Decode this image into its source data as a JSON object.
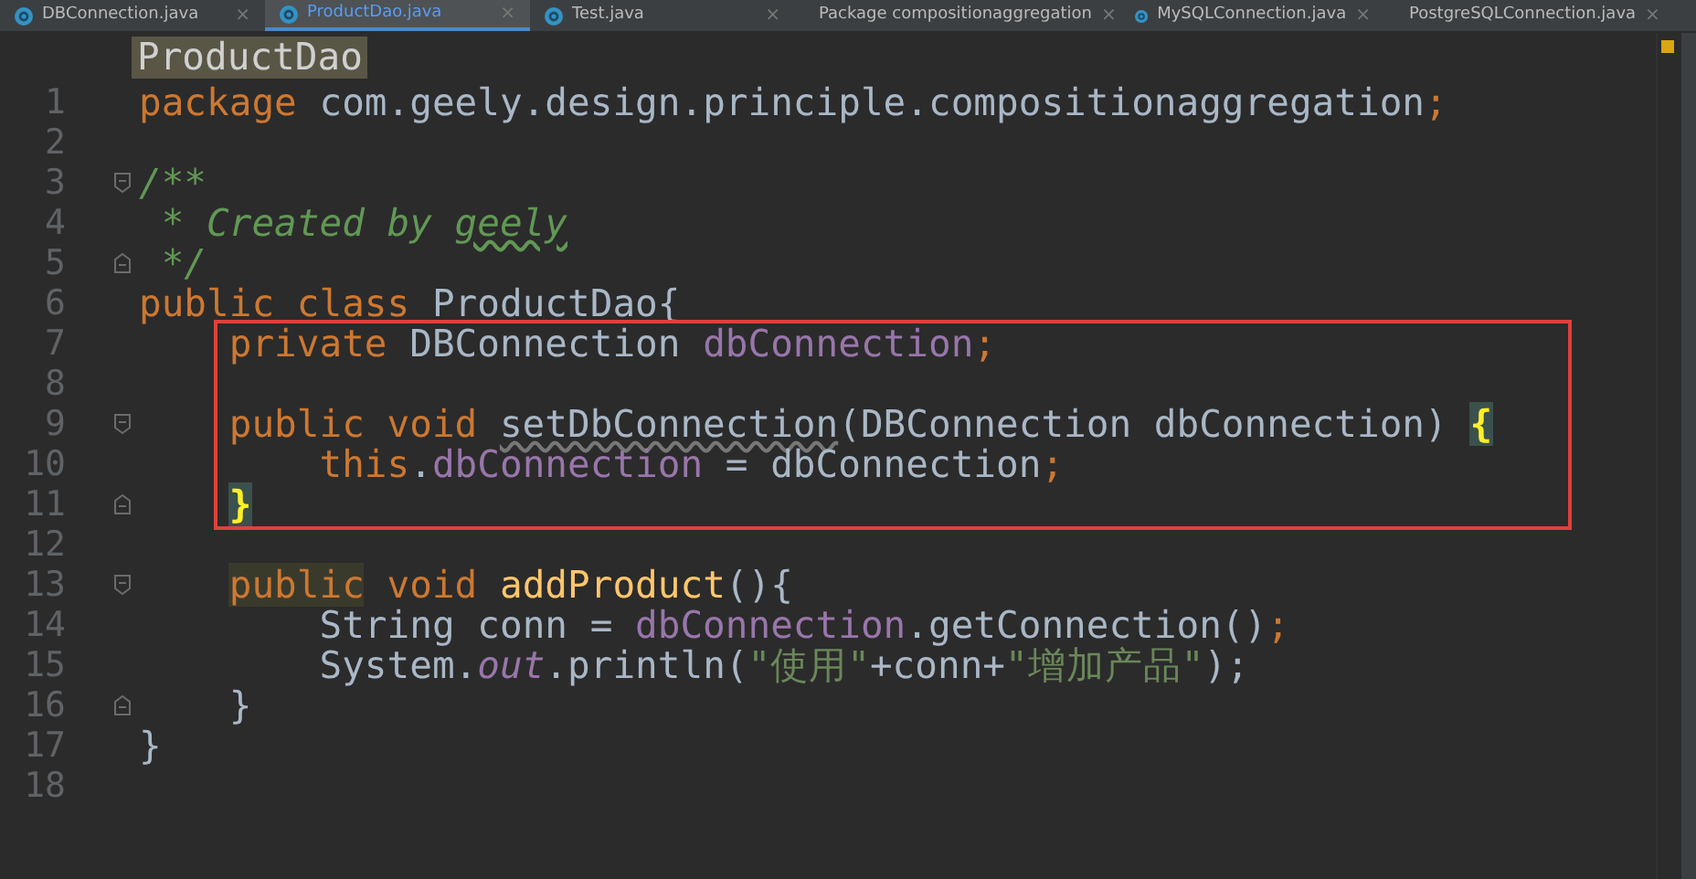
{
  "tabs": [
    {
      "label": "DBConnection.java",
      "kind": "class",
      "selected": false,
      "close": "×"
    },
    {
      "label": "ProductDao.java",
      "kind": "class",
      "selected": true,
      "close": "×"
    },
    {
      "label": "Test.java",
      "kind": "class",
      "selected": false,
      "close": "×"
    },
    {
      "label": "Package compositionaggregation",
      "kind": "package",
      "selected": false,
      "close": "×"
    },
    {
      "label": "MySQLConnection.java",
      "kind": "class",
      "selected": false,
      "close": "×"
    },
    {
      "label": "PostgreSQLConnection.java",
      "kind": "class",
      "selected": false,
      "close": "×"
    }
  ],
  "breadcrumb": "ProductDao",
  "lines": [
    {
      "number": "1",
      "boxed": false,
      "tokens": [
        {
          "text": "package ",
          "kind": "keyword"
        },
        {
          "text": "com.geely.design.principle.compositionaggregation",
          "kind": "plain"
        },
        {
          "text": ";",
          "kind": "keyword"
        }
      ]
    },
    {
      "number": "2",
      "boxed": false
    },
    {
      "number": "3",
      "boxed": false,
      "fold": {
        "kind": "start"
      },
      "tokens": [
        {
          "text": "/**",
          "kind": "doc"
        }
      ]
    },
    {
      "number": "4",
      "boxed": false,
      "tokens": [
        {
          "text": " * Created by ",
          "kind": "doc"
        },
        {
          "text": "geely",
          "kind": "doc-typo"
        }
      ]
    },
    {
      "number": "5",
      "boxed": false,
      "fold": {
        "kind": "end"
      },
      "tokens": [
        {
          "text": " */",
          "kind": "doc"
        }
      ]
    },
    {
      "number": "6",
      "boxed": false,
      "tokens": [
        {
          "text": "public class ",
          "kind": "keyword"
        },
        {
          "text": "ProductDao{",
          "kind": "plain"
        }
      ]
    },
    {
      "number": "7",
      "boxed": true,
      "tokens": [
        {
          "text": "    private ",
          "kind": "keyword"
        },
        {
          "text": "DBConnection ",
          "kind": "plain"
        },
        {
          "text": "dbConnection",
          "kind": "field"
        },
        {
          "text": ";",
          "kind": "keyword"
        }
      ]
    },
    {
      "number": "8",
      "boxed": true
    },
    {
      "number": "9",
      "boxed": true,
      "fold": {
        "kind": "start"
      },
      "tokens": [
        {
          "text": "    public void ",
          "kind": "keyword"
        },
        {
          "text": "setDbConnection",
          "kind": "unused"
        },
        {
          "text": "(DBConnection dbConnection) ",
          "kind": "plain"
        },
        {
          "text": "{",
          "kind": "brace-match"
        }
      ]
    },
    {
      "number": "10",
      "boxed": true,
      "tokens": [
        {
          "text": "        this",
          "kind": "keyword"
        },
        {
          "text": ".",
          "kind": "plain"
        },
        {
          "text": "dbConnection",
          "kind": "field"
        },
        {
          "text": " = dbConnection",
          "kind": "plain"
        },
        {
          "text": ";",
          "kind": "keyword"
        }
      ]
    },
    {
      "number": "11",
      "boxed": true,
      "fold": {
        "kind": "end"
      },
      "tokens": [
        {
          "text": "    }",
          "kind": "brace-match"
        }
      ]
    },
    {
      "number": "12",
      "boxed": false
    },
    {
      "number": "13",
      "boxed": false,
      "fold": {
        "kind": "start"
      },
      "tokens": [
        {
          "text": "    public",
          "kind": "keyword-marked"
        },
        {
          "text": " void ",
          "kind": "keyword"
        },
        {
          "text": "addProduct",
          "kind": "method"
        },
        {
          "text": "(){",
          "kind": "plain"
        }
      ]
    },
    {
      "number": "14",
      "boxed": false,
      "tokens": [
        {
          "text": "        String conn = ",
          "kind": "plain"
        },
        {
          "text": "dbConnection",
          "kind": "field"
        },
        {
          "text": ".getConnection()",
          "kind": "plain"
        },
        {
          "text": ";",
          "kind": "keyword"
        }
      ]
    },
    {
      "number": "15",
      "boxed": false,
      "tokens": [
        {
          "text": "        System.",
          "kind": "plain"
        },
        {
          "text": "out",
          "kind": "static"
        },
        {
          "text": ".println(",
          "kind": "plain"
        },
        {
          "text": "\"使用\"",
          "kind": "string"
        },
        {
          "text": "+conn+",
          "kind": "plain"
        },
        {
          "text": "\"增加产品\"",
          "kind": "string"
        },
        {
          "text": ");",
          "kind": "plain"
        }
      ]
    },
    {
      "number": "16",
      "boxed": false,
      "fold": {
        "kind": "end"
      },
      "tokens": [
        {
          "text": "    }",
          "kind": "plain"
        }
      ]
    },
    {
      "number": "17",
      "boxed": false,
      "tokens": [
        {
          "text": "}",
          "kind": "plain"
        }
      ]
    },
    {
      "number": "18",
      "boxed": false
    }
  ]
}
